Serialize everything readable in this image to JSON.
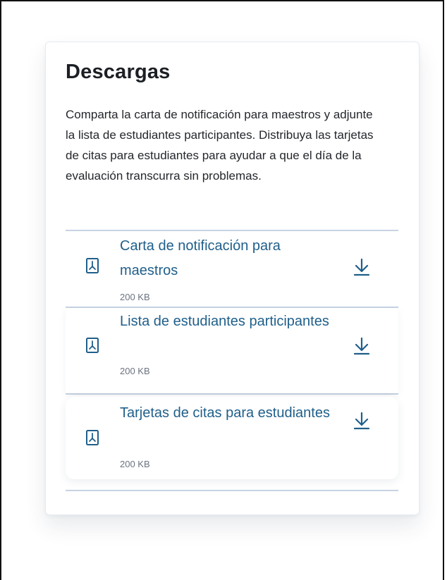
{
  "card": {
    "title": "Descargas",
    "description": "Comparta la carta de notificación para maestros y adjunte la lista de estudiantes participantes. Distribuya las tarjetas de citas para estudiantes para ayudar a que el día de la evaluación transcurra sin problemas."
  },
  "downloads": [
    {
      "title": "Carta de notificación para maestros",
      "size": "200 KB",
      "file_icon": "pdf-icon",
      "action_icon": "download-icon"
    },
    {
      "title": "Lista de estudiantes participantes",
      "size": "200 KB",
      "file_icon": "pdf-icon",
      "action_icon": "download-icon"
    },
    {
      "title": "Tarjetas de citas para estudiantes",
      "size": "200 KB",
      "file_icon": "pdf-icon",
      "action_icon": "download-icon"
    }
  ],
  "colors": {
    "link": "#1f5f8b",
    "divider": "#c6d3e2",
    "text": "#24272c"
  }
}
